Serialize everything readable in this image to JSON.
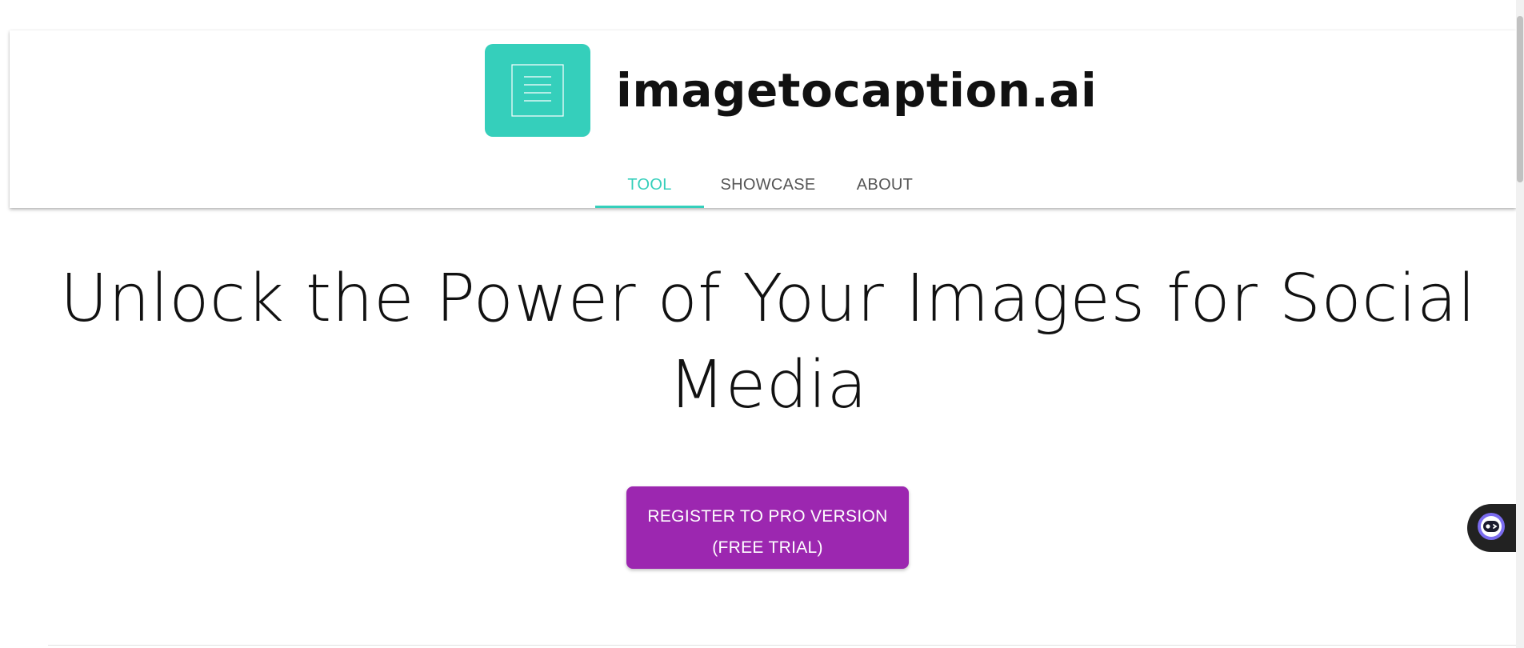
{
  "brand": {
    "name": "imagetocaption.ai",
    "logo_color": "#35cfbb"
  },
  "nav": {
    "tabs": [
      {
        "label": "TOOL",
        "active": true
      },
      {
        "label": "SHOWCASE",
        "active": false
      },
      {
        "label": "ABOUT",
        "active": false
      }
    ],
    "active_color": "#35cfbb"
  },
  "hero": {
    "line1": "Unlock the Power of Your Images for Social",
    "line2": "Media"
  },
  "cta": {
    "line1": "REGISTER TO PRO VERSION",
    "line2": "(FREE TRIAL)",
    "color": "#9c27b0"
  },
  "chat_widget": {
    "icon": "chat-bot-icon"
  }
}
